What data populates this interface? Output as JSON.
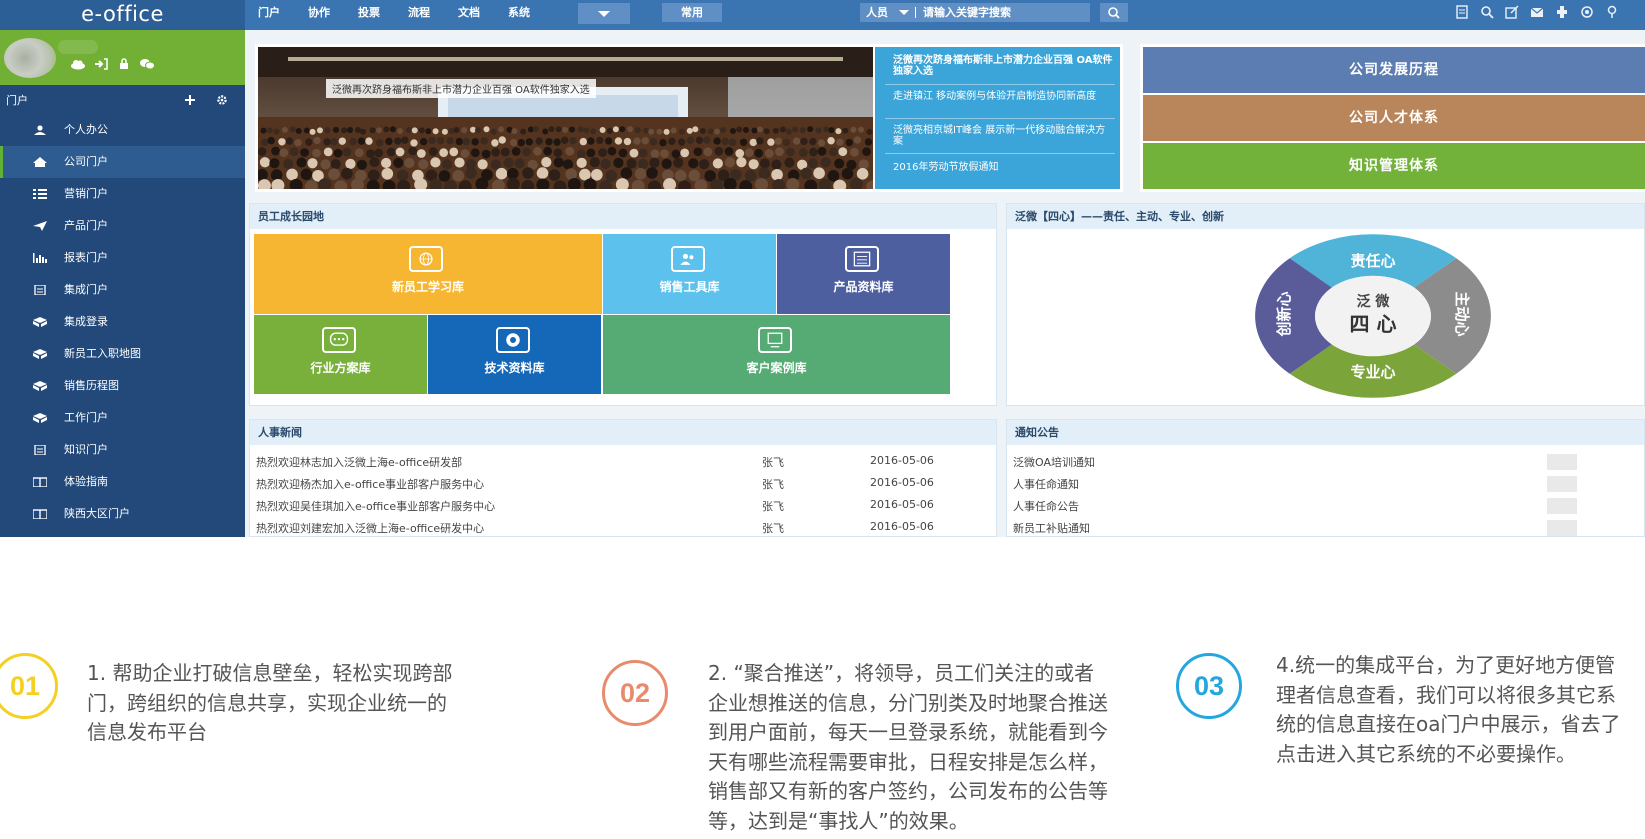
{
  "app": {
    "logo": "e-office",
    "topnav": [
      "门户",
      "协作",
      "投票",
      "流程",
      "文档",
      "系统"
    ],
    "common_label": "常用",
    "search_scope": "人员",
    "search_placeholder": "请输入关键字搜索",
    "tool_icons": [
      "document-icon",
      "search-icon",
      "external-icon",
      "mail-icon",
      "settings-icon",
      "eye-icon",
      "location-icon"
    ]
  },
  "sidebar": {
    "section_title": "门户",
    "items": [
      {
        "label": "个人办公",
        "icon": "user-icon"
      },
      {
        "label": "公司门户",
        "icon": "home-icon",
        "active": true
      },
      {
        "label": "营销门户",
        "icon": "grid-icon"
      },
      {
        "label": "产品门户",
        "icon": "send-icon"
      },
      {
        "label": "报表门户",
        "icon": "bar-chart-icon"
      },
      {
        "label": "集成门户",
        "icon": "document-icon"
      },
      {
        "label": "集成登录",
        "icon": "cube-icon"
      },
      {
        "label": "新员工入职地图",
        "icon": "cube-icon"
      },
      {
        "label": "销售历程图",
        "icon": "cube-icon"
      },
      {
        "label": "工作门户",
        "icon": "cube-icon"
      },
      {
        "label": "知识门户",
        "icon": "document-icon"
      },
      {
        "label": "体验指南",
        "icon": "book-icon"
      },
      {
        "label": "陕西大区门户",
        "icon": "book-icon"
      }
    ]
  },
  "banner": {
    "caption": "泛微再次跻身福布斯非上市潜力企业百强 OA软件独家入选",
    "news": [
      "泛微再次跻身福布斯非上市潜力企业百强 OA软件独家入选",
      "走进镇江 移动案例与体验开启制造协同新高度",
      "泛微亮相京城IT峰会 展示新一代移动融合解决方案",
      "2016年劳动节放假通知"
    ]
  },
  "links": [
    {
      "label": "公司发展历程",
      "color": "#5c7db1"
    },
    {
      "label": "公司人才体系",
      "color": "#b8865a"
    },
    {
      "label": "知识管理体系",
      "color": "#72b23b"
    }
  ],
  "growth": {
    "title": "员工成长园地",
    "tiles": [
      {
        "label": "新员工学习库",
        "color": "#f6b631",
        "icon": "globe-icon"
      },
      {
        "label": "销售工具库",
        "color": "#5cc2ed",
        "icon": "contacts-icon"
      },
      {
        "label": "产品资料库",
        "color": "#4d5f9f",
        "icon": "newspaper-icon"
      },
      {
        "label": "行业方案库",
        "color": "#79b03c",
        "icon": "chat-icon"
      },
      {
        "label": "技术资料库",
        "color": "#1567b8",
        "icon": "aperture-icon"
      },
      {
        "label": "客户案例库",
        "color": "#55ab73",
        "icon": "monitor-icon"
      }
    ]
  },
  "values": {
    "title": "泛微【四心】——责任、主动、专业、创新",
    "center_top": "泛 微",
    "center_bottom": "四  心",
    "segments": {
      "top": "责任心",
      "right": "主动心",
      "bottom": "专业心",
      "left": "创新心"
    }
  },
  "hr_news": {
    "title": "人事新闻",
    "rows": [
      {
        "text": "热烈欢迎林志加入泛微上海e-office研发部",
        "author": "张飞",
        "date": "2016-05-06"
      },
      {
        "text": "热烈欢迎杨杰加入e-office事业部客户服务中心",
        "author": "张飞",
        "date": "2016-05-06"
      },
      {
        "text": "热烈欢迎吴佳琪加入e-office事业部客户服务中心",
        "author": "张飞",
        "date": "2016-05-06"
      },
      {
        "text": "热烈欢迎刘建宏加入泛微上海e-office研发中心",
        "author": "张飞",
        "date": "2016-05-06"
      }
    ]
  },
  "notices": {
    "title": "通知公告",
    "rows": [
      "泛微OA培训通知",
      "人事任命通知",
      "人事任命公告",
      "新员工补贴通知"
    ]
  },
  "features": [
    {
      "num": "01",
      "color": "#f3d023",
      "text": [
        "1. 帮助企业打破信息壁垒，轻松实现跨部",
        "门，跨组织的信息共享，实现企业统一的",
        "信息发布平台"
      ]
    },
    {
      "num": "02",
      "color": "#ea8a6d",
      "text": [
        "2. “聚合推送”，将领导，员工们关注的或者",
        "企业想推送的信息，分门别类及时地聚合推送",
        "到用户面前，每天一旦登录系统，就能看到今",
        "天有哪些流程需要审批，日程安排是怎么样，",
        "销售部又有新的客户签约，公司发布的公告等",
        "等，达到是“事找人”的效果。"
      ]
    },
    {
      "num": "03",
      "color": "#24a6de",
      "text": [
        "4.统一的集成平台，为了更好地方便管",
        "理者信息查看，我们可以将很多其它系",
        "统的信息直接在oa门户中展示，省去了",
        "点击进入其它系统的不必要操作。"
      ]
    }
  ]
}
